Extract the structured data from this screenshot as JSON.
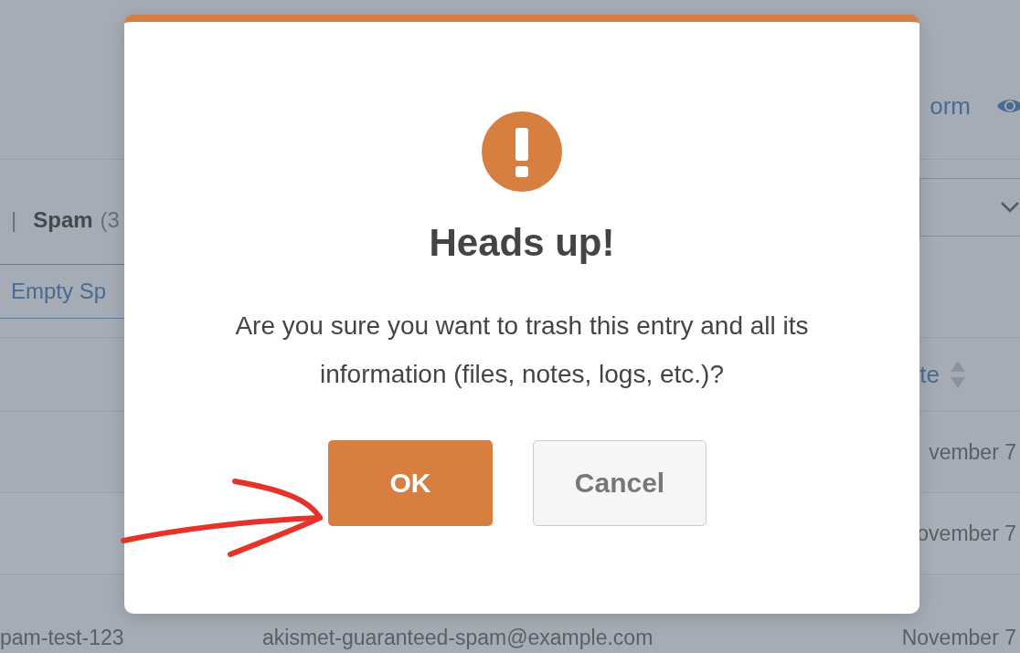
{
  "page": {
    "header_link": "orm",
    "filter": {
      "separator": "|",
      "label": "Spam",
      "count": "(3"
    },
    "empty_button": "Empty Sp",
    "sort_column": "te",
    "rows": [
      {
        "id": "",
        "email": "",
        "date": "vember 7"
      },
      {
        "id": "",
        "email": "",
        "date": "ovember 7"
      },
      {
        "id": "pam-test-123",
        "email": "akismet-guaranteed-spam@example.com",
        "date": "November 7"
      }
    ]
  },
  "modal": {
    "title": "Heads up!",
    "message": "Are you sure you want to trash this entry and all its information (files, notes, logs, etc.)?",
    "buttons": [
      {
        "label": "OK",
        "kind": "primary"
      },
      {
        "label": "Cancel",
        "kind": "secondary"
      }
    ]
  }
}
